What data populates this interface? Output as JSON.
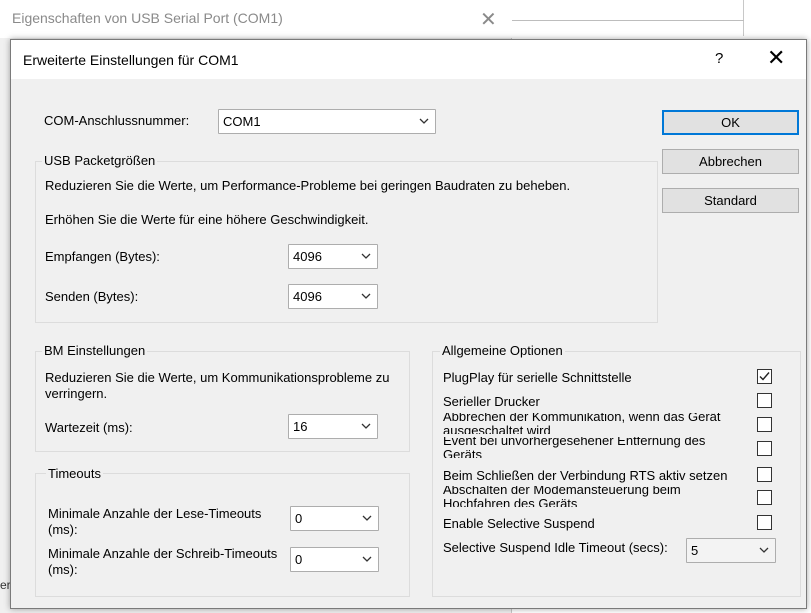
{
  "background": {
    "window_title": "Eigenschaften von USB Serial Port (COM1)",
    "close_glyph": "✕",
    "fragment_bottom_left": "erä"
  },
  "dialog": {
    "title": "Erweiterte Einstellungen für COM1",
    "help_glyph": "?",
    "close_glyph": "✕",
    "com_port_label": "COM-Anschlussnummer:",
    "com_port_value": "COM1",
    "buttons": {
      "ok": "OK",
      "cancel": "Abbrechen",
      "default": "Standard"
    },
    "usb_group": {
      "title": "USB Packetgrößen",
      "line1": "Reduzieren Sie die Werte, um Performance-Probleme bei geringen Baudraten zu beheben.",
      "line2": "Erhöhen Sie die Werte für eine höhere Geschwindigkeit.",
      "receive_label": "Empfangen (Bytes):",
      "receive_value": "4096",
      "send_label": "Senden (Bytes):",
      "send_value": "4096"
    },
    "bm_group": {
      "title": "BM Einstellungen",
      "text": "Reduzieren Sie die Werte, um Kommunikationsprobleme zu verringern.",
      "latency_label": "Wartezeit (ms):",
      "latency_value": "16"
    },
    "timeouts_group": {
      "title": "Timeouts",
      "read_label": "Minimale Anzahle der Lese-Timeouts (ms):",
      "read_value": "0",
      "write_label": "Minimale Anzahle der Schreib-Timeouts (ms):",
      "write_value": "0"
    },
    "options_group": {
      "title": "Allgemeine Optionen",
      "options": [
        {
          "label": "PlugPlay für serielle Schnittstelle",
          "checked": true
        },
        {
          "label": "Serieller Drucker",
          "checked": false
        },
        {
          "label": "Abbrechen der Kommunikation, wenn das Gerät ausgeschaltet wird",
          "checked": false
        },
        {
          "label": "Event bei unvorhergesehener Entfernung des Geräts",
          "checked": false
        },
        {
          "label": "Beim Schließen der Verbindung RTS aktiv setzen",
          "checked": false
        },
        {
          "label": "Abschalten der Modemansteuerung beim Hochfahren des Geräts",
          "checked": false
        },
        {
          "label": "Enable Selective Suspend",
          "checked": false
        }
      ],
      "idle_timeout_label": "Selective Suspend Idle Timeout (secs):",
      "idle_timeout_value": "5"
    }
  }
}
